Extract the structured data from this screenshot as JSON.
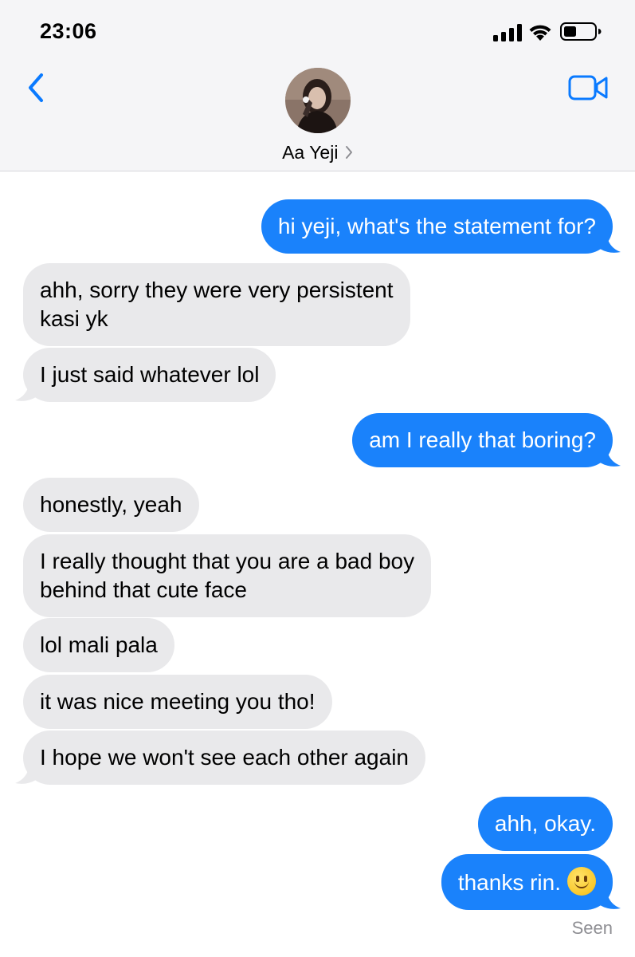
{
  "status_bar": {
    "time": "23:06"
  },
  "header": {
    "contact_name": "Aa Yeji"
  },
  "messages": [
    {
      "side": "out",
      "lines": [
        "hi yeji, what's the statement for?"
      ]
    },
    {
      "side": "in",
      "lines": [
        "ahh, sorry they were very persistent",
        "kasi yk"
      ]
    },
    {
      "side": "in",
      "lines": [
        "I just said whatever lol"
      ]
    },
    {
      "side": "out",
      "lines": [
        "am I really that boring?"
      ]
    },
    {
      "side": "in",
      "lines": [
        "honestly, yeah"
      ]
    },
    {
      "side": "in",
      "lines": [
        "I really thought that you are a bad boy",
        "behind that cute face"
      ]
    },
    {
      "side": "in",
      "lines": [
        "lol mali pala"
      ]
    },
    {
      "side": "in",
      "lines": [
        "it was nice meeting you tho!"
      ]
    },
    {
      "side": "in",
      "lines": [
        "I hope we won't see each other again"
      ]
    },
    {
      "side": "out",
      "lines": [
        "ahh, okay."
      ]
    },
    {
      "side": "out",
      "lines": [
        "thanks rin."
      ],
      "emoji": "slightly-smiling-face"
    }
  ],
  "receipt": "Seen",
  "colors": {
    "outgoing": "#1a82fb",
    "incoming": "#e9e9eb",
    "accent": "#0a7aff"
  },
  "icons": [
    "back-chevron-icon",
    "video-camera-icon",
    "cellular-signal-icon",
    "wifi-icon",
    "battery-icon"
  ]
}
